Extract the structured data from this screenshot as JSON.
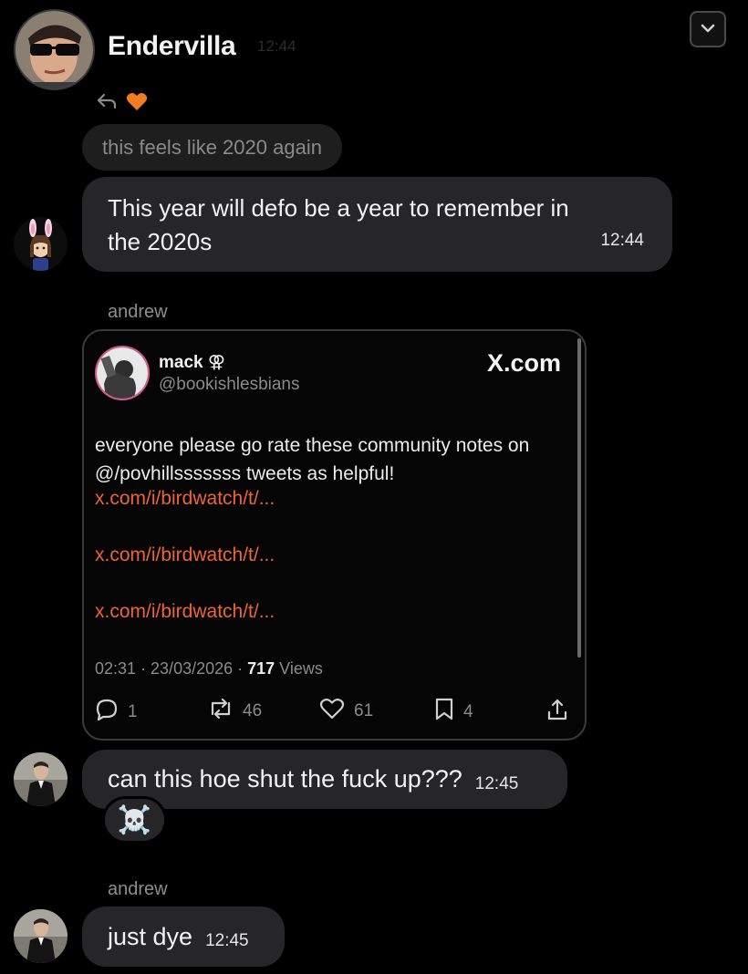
{
  "header": {
    "name": "Endervilla",
    "time": "12:44",
    "collapse_icon": "chevron-down-icon"
  },
  "reply_meta": {
    "reply_icon": "reply-arrow-icon",
    "heart_color": "#f07d22"
  },
  "quoted_message": {
    "text": "this feels like 2020 again"
  },
  "messages": [
    {
      "text_line1": "This year will defo be a year to remember in",
      "text_line2": "the 2020s",
      "time": "12:44"
    },
    {
      "text": "can this hoe shut the fuck up???",
      "time": "12:45",
      "reaction": "☠️"
    },
    {
      "text": "just dye",
      "time": "12:45"
    }
  ],
  "senders": {
    "card_sender": "andrew",
    "last_sender": "andrew"
  },
  "embed": {
    "author_name": "mack ⚢",
    "author_handle": "@bookishlesbians",
    "source": "X.com",
    "text_line1": "everyone please go rate these community notes on",
    "text_line2": "@/povhillsssssss tweets as helpful!",
    "links": [
      "x.com/i/birdwatch/t/...",
      "x.com/i/birdwatch/t/...",
      "x.com/i/birdwatch/t/..."
    ],
    "meta_prefix": "02:31 · 23/03/2026 · ",
    "views_count": "717",
    "views_label": " Views",
    "stats": {
      "replies": "1",
      "reposts": "46",
      "likes": "61",
      "bookmarks": "4"
    },
    "link_color": "#f0642e"
  },
  "colors": {
    "bubble": "#262628",
    "background": "#000000",
    "accent": "#f0642e"
  }
}
